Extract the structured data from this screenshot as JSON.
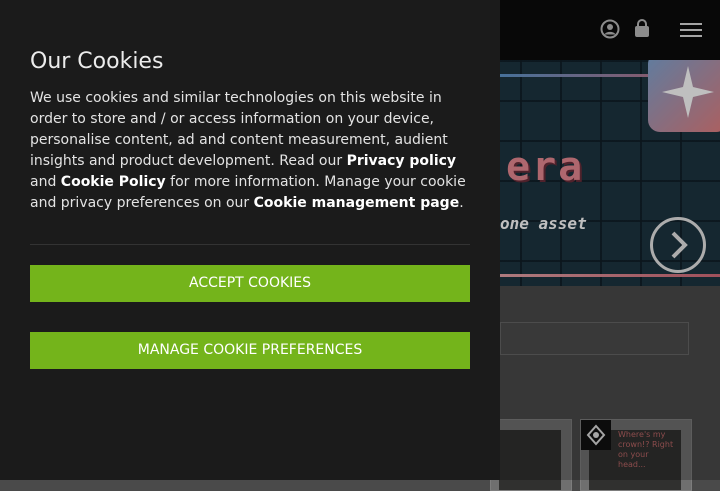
{
  "header": {
    "account_icon": "user-circle-icon",
    "cart_icon": "shopping-bag-icon",
    "menu_icon": "hamburger-menu-icon"
  },
  "hero": {
    "title_fragment": "era",
    "subtitle_fragment": "one asset",
    "arrow_icon": "chevron-right-icon"
  },
  "content": {
    "card_text": "Where's my crown!? Right on your head..."
  },
  "cookie": {
    "title": "Our Cookies",
    "text_1": "We use cookies and similar technologies on this website in order to store and / or access information on your device, personalise content, ad and content measurement, audient insights and product development. Read our ",
    "privacy_link": "Privacy policy",
    "text_2": " and ",
    "cookie_link": "Cookie Policy",
    "text_3": " for more information. Manage your cookie and privacy preferences on our ",
    "management_link": "Cookie management page",
    "text_4": ".",
    "accept_label": "ACCEPT COOKIES",
    "manage_label": "MANAGE COOKIE PREFERENCES"
  },
  "colors": {
    "panel_bg": "#1b1b1b",
    "button_green": "#74b41b"
  }
}
